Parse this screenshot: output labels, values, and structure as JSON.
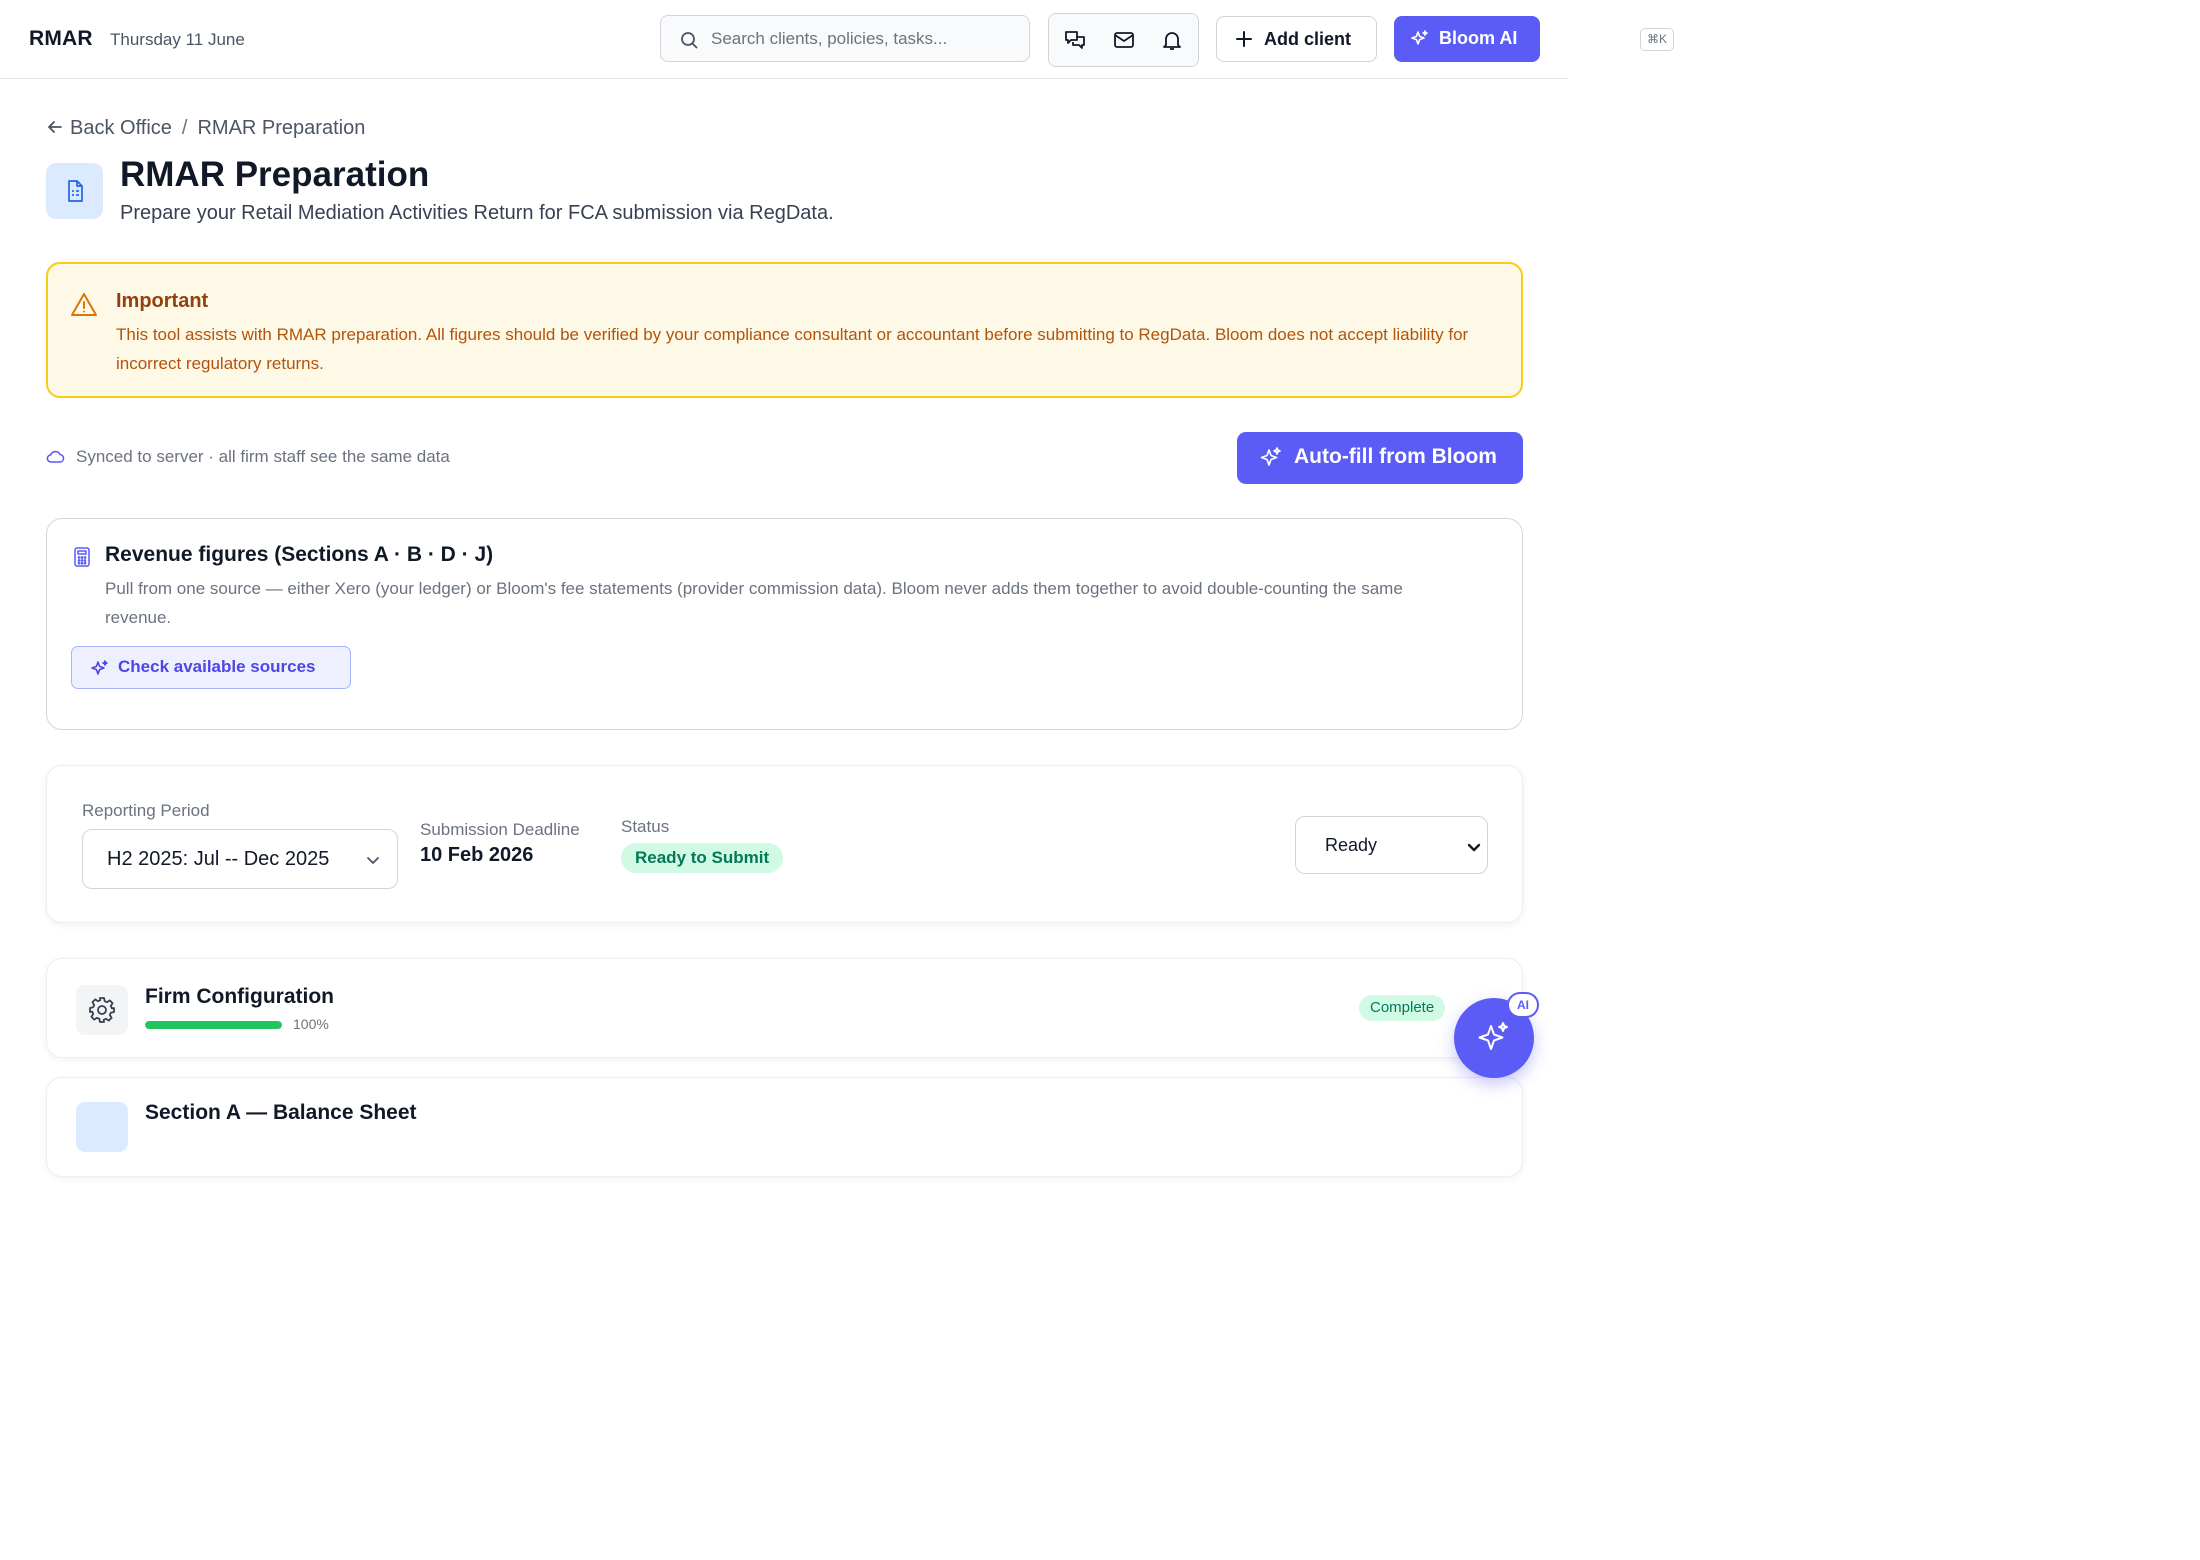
{
  "header": {
    "brand": "RMAR",
    "date": "Thursday 11 June",
    "search_placeholder": "Search clients, policies, tasks...",
    "search_shortcut": "⌘K",
    "add_client_label": "Add client",
    "bloom_ai_label": "Bloom AI",
    "icons": [
      "chat-icon",
      "mail-icon",
      "bell-icon"
    ]
  },
  "breadcrumb": {
    "back_label": "Back Office",
    "separator": "/",
    "current": "RMAR Preparation"
  },
  "page": {
    "title": "RMAR Preparation",
    "subtitle": "Prepare your Retail Mediation Activities Return for FCA submission via RegData."
  },
  "warning": {
    "title": "Important",
    "body": "This tool assists with RMAR preparation. All figures should be verified by your compliance consultant or accountant before submitting to RegData. Bloom does not accept liability for incorrect regulatory returns."
  },
  "sync": {
    "text": "Synced to server · all firm staff see the same data",
    "autofill_label": "Auto-fill from Bloom"
  },
  "revenue": {
    "title": "Revenue figures (Sections A · B · D · J)",
    "body": "Pull from one source — either Xero (your ledger) or Bloom's fee statements (provider commission data). Bloom never adds them together to avoid double-counting the same revenue.",
    "check_label": "Check available sources"
  },
  "period": {
    "reporting_label": "Reporting Period",
    "reporting_value": "H2 2025: Jul -- Dec 2025",
    "deadline_label": "Submission Deadline",
    "deadline_value": "10 Feb 2026",
    "status_label": "Status",
    "status_value": "Ready to Submit",
    "status_select_value": "Ready"
  },
  "sections": [
    {
      "title": "Firm Configuration",
      "progress": 100,
      "progress_label": "100%",
      "badge": "Complete"
    },
    {
      "title": "Section A — Balance Sheet"
    }
  ],
  "fab": {
    "tag": "AI"
  },
  "colors": {
    "accent": "#5b5bf6",
    "warning_border": "#facc15",
    "warning_bg": "#fef9e7",
    "success": "#22c55e"
  }
}
